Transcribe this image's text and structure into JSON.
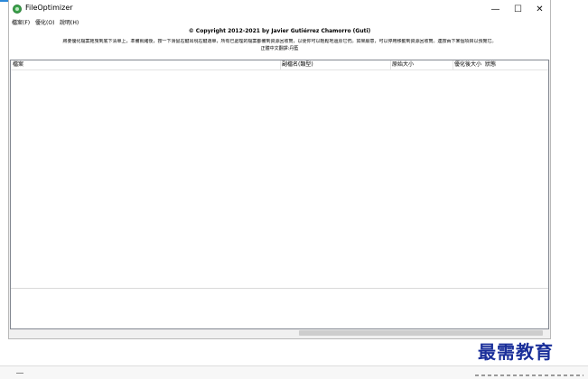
{
  "window": {
    "title": "FileOptimizer",
    "controls": {
      "minimize": "—",
      "maximize": "☐",
      "close": "✕"
    }
  },
  "menu": [
    {
      "label": "檔案(F)"
    },
    {
      "label": "優化(O)"
    },
    {
      "label": "說明(H)"
    }
  ],
  "info": {
    "copyright": "© Copyright 2012-2021 by Javier Gutiérrez Chamorro (Guti)",
    "instructions": "將要優化檔案拖曳到底下清單上，準備就緒後，按一下滑鼠右鍵出現右鍵選單，所有已處理的檔案都備到資源回收筒，以便你可以輕鬆地還原它們。如果願意，可以停用移動到資源回收筒。連按兩下某個項目以預覽它。",
    "translator": "正體中文翻譯:丹藍"
  },
  "file_list": {
    "columns": [
      {
        "label": "檔案"
      },
      {
        "label": "副檔名(類型)"
      },
      {
        "label": "原始大小"
      },
      {
        "label": "優化後大小"
      },
      {
        "label": "狀態"
      }
    ],
    "rows": []
  },
  "watermark": "最需教育",
  "colors": {
    "accent": "#2b88d8",
    "app_icon": "#3aa24a",
    "watermark": "#1a2f9a"
  }
}
